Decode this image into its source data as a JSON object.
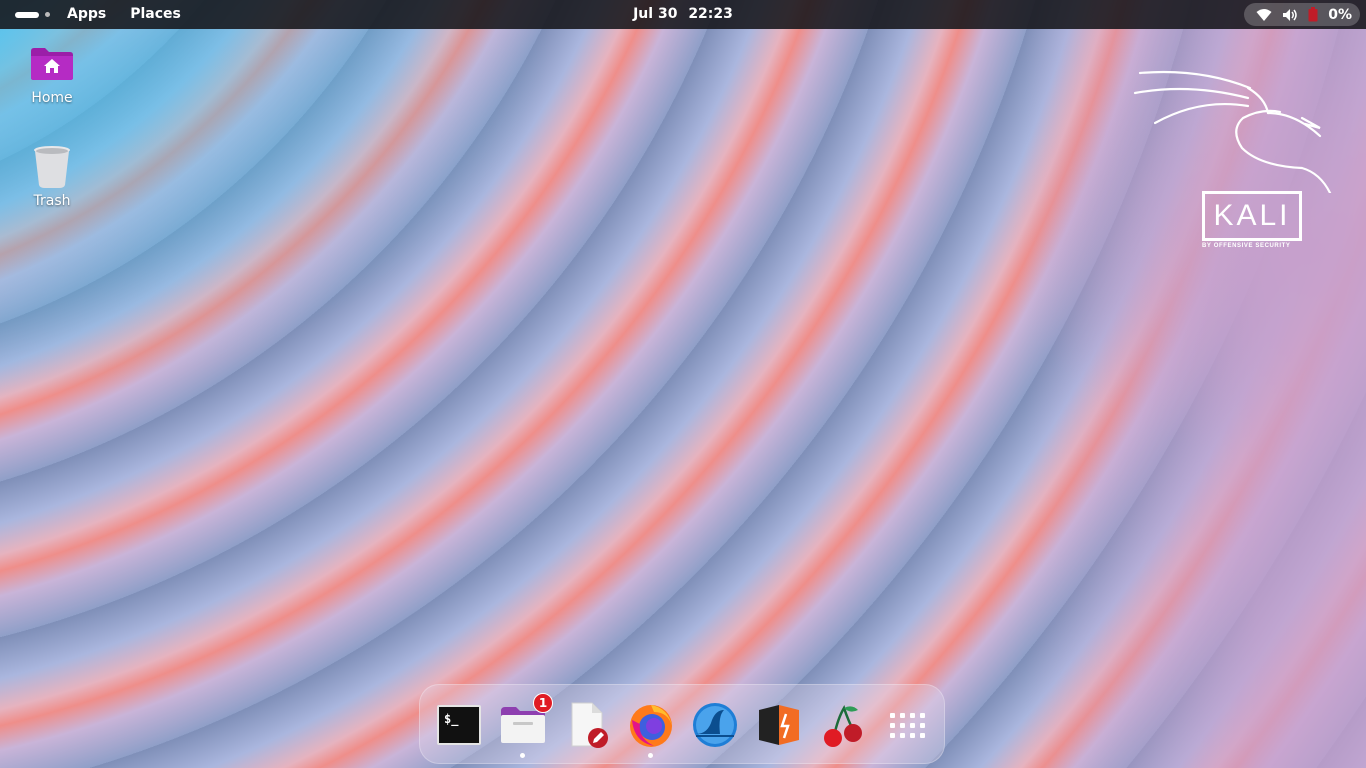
{
  "topbar": {
    "apps_label": "Apps",
    "places_label": "Places",
    "clock": {
      "date": "Jul 30",
      "time": "22:23"
    },
    "battery_percent": "0%"
  },
  "desktop": {
    "icons": [
      {
        "label": "Home",
        "icon": "home-folder-icon"
      },
      {
        "label": "Trash",
        "icon": "trash-icon"
      }
    ],
    "logo": {
      "wordmark": "KALI",
      "tagline": "BY OFFENSIVE SECURITY"
    }
  },
  "dock": {
    "items": [
      {
        "name": "terminal",
        "icon": "terminal-icon",
        "glyph": "$_"
      },
      {
        "name": "files",
        "icon": "files-icon",
        "badge": "1",
        "running": true
      },
      {
        "name": "text-editor",
        "icon": "text-editor-icon"
      },
      {
        "name": "firefox",
        "icon": "firefox-icon",
        "running": true
      },
      {
        "name": "wireshark",
        "icon": "wireshark-icon"
      },
      {
        "name": "burpsuite",
        "icon": "burpsuite-icon"
      },
      {
        "name": "cherrytree",
        "icon": "cherrytree-icon"
      },
      {
        "name": "show-apps",
        "icon": "app-grid-icon"
      }
    ]
  },
  "colors": {
    "topbar_bg": "#16161a",
    "folder_purple": "#9b1ea8",
    "badge_red": "#e01b24",
    "burp_orange": "#f26c23"
  }
}
